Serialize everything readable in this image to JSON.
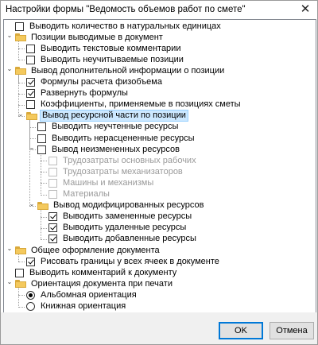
{
  "window": {
    "title": "Настройки формы \"Ведомость объемов работ по смете\"",
    "close_glyph": "✕"
  },
  "tree": [
    {
      "id": "r0",
      "type": "checkbox",
      "label": "Выводить количество в натуральных единицах",
      "checked": false
    },
    {
      "id": "r1",
      "type": "folder",
      "label": "Позиции выводимые в документ",
      "expanded": true
    },
    {
      "id": "r2",
      "type": "checkbox",
      "label": "Выводить текстовые комментарии",
      "checked": false
    },
    {
      "id": "r3",
      "type": "checkbox",
      "label": "Выводить неучитываемые позиции",
      "checked": false
    },
    {
      "id": "r4",
      "type": "folder",
      "label": "Вывод дополнительной информации о позиции",
      "expanded": true
    },
    {
      "id": "r5",
      "type": "checkbox",
      "label": "Формулы расчета физобъема",
      "checked": true
    },
    {
      "id": "r6",
      "type": "checkbox",
      "label": "Развернуть формулы",
      "checked": true
    },
    {
      "id": "r7",
      "type": "checkbox",
      "label": "Коэффициенты, применяемые в позициях сметы",
      "checked": false
    },
    {
      "id": "r8",
      "type": "folder",
      "label": "Вывод ресурсной части по позиции",
      "expanded": true,
      "selected": true
    },
    {
      "id": "r9",
      "type": "checkbox",
      "label": "Выводить неучтенные ресурсы",
      "checked": false
    },
    {
      "id": "r10",
      "type": "checkbox",
      "label": "Выводить нерасцененные ресурсы",
      "checked": false
    },
    {
      "id": "r11",
      "type": "checkbox",
      "label": "Вывод неизмененных ресурсов",
      "checked": false,
      "expanded": true
    },
    {
      "id": "r12",
      "type": "checkbox",
      "label": "Трудозатраты основных рабочих",
      "checked": false,
      "disabled": true
    },
    {
      "id": "r13",
      "type": "checkbox",
      "label": "Трудозатраты механизаторов",
      "checked": false,
      "disabled": true
    },
    {
      "id": "r14",
      "type": "checkbox",
      "label": "Машины и механизмы",
      "checked": false,
      "disabled": true
    },
    {
      "id": "r15",
      "type": "checkbox",
      "label": "Материалы",
      "checked": false,
      "disabled": true
    },
    {
      "id": "r16",
      "type": "folder",
      "label": "Вывод модифицированных ресурсов",
      "expanded": true
    },
    {
      "id": "r17",
      "type": "checkbox",
      "label": "Выводить замененные ресурсы",
      "checked": true
    },
    {
      "id": "r18",
      "type": "checkbox",
      "label": "Выводить удаленные ресурсы",
      "checked": true
    },
    {
      "id": "r19",
      "type": "checkbox",
      "label": "Выводить добавленные ресурсы",
      "checked": true
    },
    {
      "id": "r20",
      "type": "folder",
      "label": "Общее оформление документа",
      "expanded": true
    },
    {
      "id": "r21",
      "type": "checkbox",
      "label": "Рисовать границы у всех ячеек в документе",
      "checked": true
    },
    {
      "id": "r22",
      "type": "checkbox",
      "label": "Выводить комментарий к документу",
      "checked": false
    },
    {
      "id": "r23",
      "type": "folder",
      "label": "Ориентация документа при печати",
      "expanded": true
    },
    {
      "id": "r24",
      "type": "radio",
      "label": "Альбомная ориентация",
      "checked": true
    },
    {
      "id": "r25",
      "type": "radio",
      "label": "Книжная ориентация",
      "checked": false
    }
  ],
  "buttons": {
    "ok": "OK",
    "cancel": "Отмена"
  }
}
